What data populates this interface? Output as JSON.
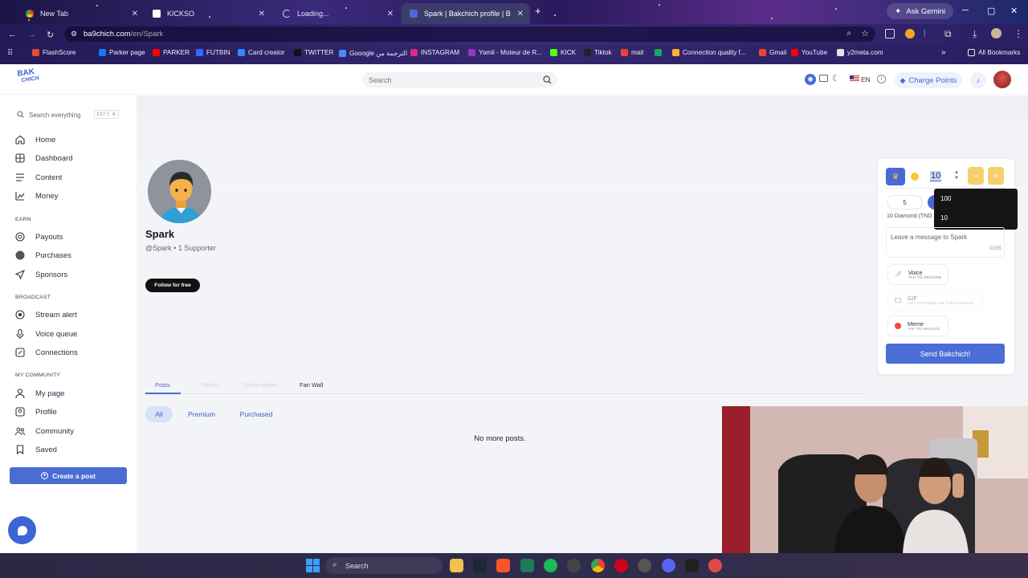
{
  "browser": {
    "tabs": [
      {
        "title": "New Tab",
        "icon": "chrome-icon"
      },
      {
        "title": "KICKSO",
        "icon": "kickso-icon"
      },
      {
        "title": "Loading...",
        "icon": "loading-spinner-icon"
      },
      {
        "title": "Spark | Bakchich profile | Bakchich",
        "icon": "bakchich-icon",
        "active": true
      }
    ],
    "new_tab": "+",
    "ask_gemini": "Ask Gemini",
    "url_domain": "ba9chich.com",
    "url_path": "/en/Spark",
    "bookmarks": [
      {
        "label": "FlashScore",
        "icon": "flashscore-icon",
        "color": "#e34a3b"
      },
      {
        "label": "Parker page",
        "icon": "facebook-icon",
        "color": "#1877f2"
      },
      {
        "label": "PARKER",
        "icon": "youtube-icon",
        "color": "#ff0000"
      },
      {
        "label": "FUTBIN",
        "icon": "futbin-icon",
        "color": "#2b6cff"
      },
      {
        "label": "Card creator",
        "icon": "card-creator-icon",
        "color": "#2a8cff"
      },
      {
        "label": "TWITTER",
        "icon": "x-icon",
        "color": "#111111"
      },
      {
        "label": "Gooogle الترجمة من",
        "icon": "google-translate-icon",
        "color": "#4a8cf7"
      },
      {
        "label": "INSTAGRAM",
        "icon": "instagram-icon",
        "color": "#d6298a"
      },
      {
        "label": "Yamli - Moteur de R...",
        "icon": "yamli-icon",
        "color": "#8e3bb8"
      },
      {
        "label": "KICK",
        "icon": "kick-icon",
        "color": "#53fc18"
      },
      {
        "label": "Tiktok",
        "icon": "tiktok-icon",
        "color": "#222222"
      },
      {
        "label": "mail",
        "icon": "gmail-icon",
        "color": "#ea4335"
      },
      {
        "label": "",
        "icon": "extension-icon",
        "color": "#1fa463"
      },
      {
        "label": "Connection quality f...",
        "icon": "speedtest-icon",
        "color": "#ffb02e"
      },
      {
        "label": "Gmail",
        "icon": "gmail-icon",
        "color": "#ea4335"
      },
      {
        "label": "YouTube",
        "icon": "youtube-icon",
        "color": "#ff0000"
      },
      {
        "label": "y2meta.com",
        "icon": "y2meta-icon",
        "color": "#e3e3e3"
      }
    ],
    "all_bookmarks": "All Bookmarks"
  },
  "site": {
    "logo_line1": "BAK",
    "logo_line2": "CHICH",
    "search_placeholder": "Search",
    "language": "EN",
    "charge_points": "Charge Points",
    "accent": "#4a68d6"
  },
  "sidebar": {
    "search_placeholder": "Search everything",
    "search_shortcut": "Ctrl K",
    "items": [
      {
        "label": "Home",
        "icon": "home-icon"
      },
      {
        "label": "Dashboard",
        "icon": "dashboard-icon"
      },
      {
        "label": "Content",
        "icon": "content-icon"
      },
      {
        "label": "Money",
        "icon": "chart-icon"
      }
    ],
    "sections": [
      {
        "title": "EARN",
        "items": [
          {
            "label": "Payouts",
            "icon": "coins-icon"
          },
          {
            "label": "Purchases",
            "icon": "purchases-icon"
          },
          {
            "label": "Sponsors",
            "icon": "send-icon"
          }
        ]
      },
      {
        "title": "BROADCAST",
        "items": [
          {
            "label": "Stream alert",
            "icon": "target-icon"
          },
          {
            "label": "Voice queue",
            "icon": "microphone-icon"
          },
          {
            "label": "Connections",
            "icon": "connections-icon"
          }
        ]
      },
      {
        "title": "MY COMMUNITY",
        "items": [
          {
            "label": "My page",
            "icon": "user-icon"
          },
          {
            "label": "Profile",
            "icon": "profile-icon"
          },
          {
            "label": "Community",
            "icon": "community-icon"
          },
          {
            "label": "Saved",
            "icon": "bookmark-icon"
          }
        ]
      }
    ],
    "create_post": "Create a post"
  },
  "profile": {
    "name": "Spark",
    "handle": "@Spark • 1 Supporter",
    "follow": "Follow for free",
    "tabs": [
      "Posts",
      "Merch",
      "Subscription",
      "Fan Wall"
    ],
    "filters": [
      "All",
      "Premium",
      "Purchased"
    ],
    "empty_message": "No more posts."
  },
  "donation": {
    "amount_value": "10",
    "preset_5": "5",
    "dropdown_options": [
      "100",
      "10"
    ],
    "diamond_info": "10 Diamond (TND",
    "message_placeholder": "Leave a message to Spark",
    "char_count": "0/255",
    "voice_title": "Voice",
    "voice_sub": "TAP TO RECORD",
    "gif_title": "GIF",
    "gif_sub": "NOT OFFERED ON THIS STREAM",
    "meme_title": "Meme",
    "meme_sub": "TAP TO UPLOAD",
    "send_button": "Send Bakchich!"
  },
  "taskbar": {
    "search": "Search"
  }
}
